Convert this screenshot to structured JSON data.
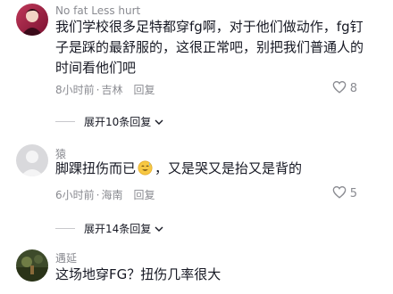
{
  "comments": [
    {
      "username": "No fat Less hurt",
      "text": "我们学校很多足特都穿fg啊，对于他们做动作，fg钉子是踩的最舒服的，这很正常吧，别把我们普通人的时间看他们吧",
      "time": "8小时前",
      "location": "吉林",
      "reply_label": "回复",
      "likes": "8",
      "expand_label": "展开10条回复"
    },
    {
      "username": "猿",
      "text_before": "脚踝扭伤而已",
      "text_after": "，又是哭又是抬又是背的",
      "time": "6小时前",
      "location": "海南",
      "reply_label": "回复",
      "likes": "5",
      "expand_label": "展开14条回复"
    },
    {
      "username": "遇延",
      "text": "这场地穿FG？扭伤几率很大"
    }
  ],
  "separator": "·",
  "icons": {
    "like": "heart-outline-icon",
    "expand": "chevron-down-icon",
    "emoji": "sweat-smile-emoji"
  }
}
